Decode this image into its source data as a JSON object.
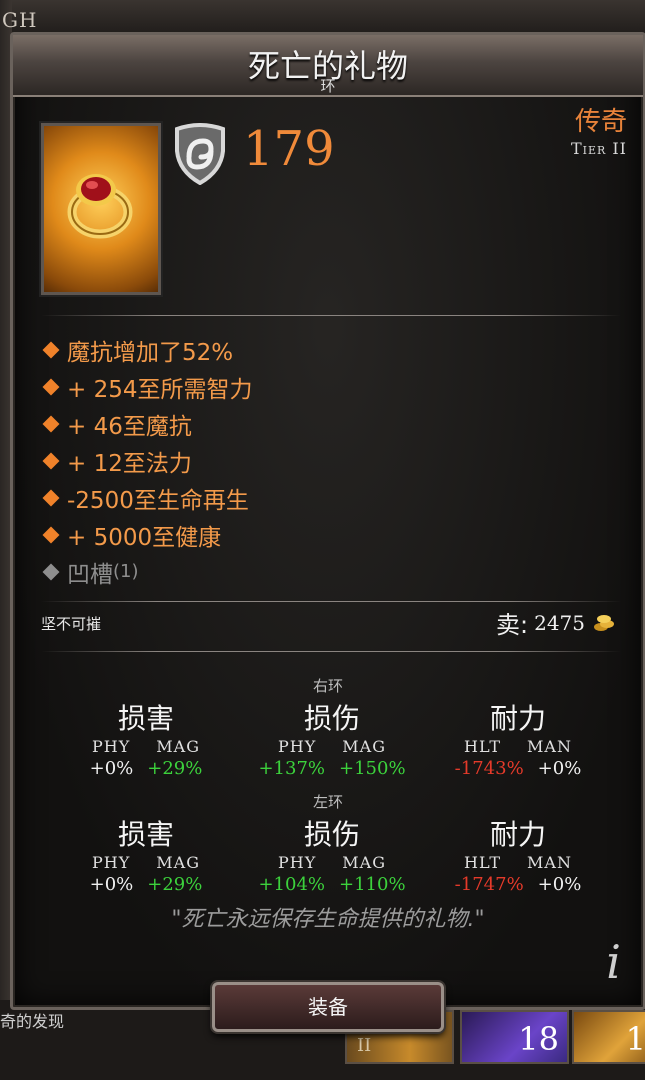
{
  "background": {
    "top_tag": "GH",
    "bottom_left_text": "奇的发现",
    "slots": [
      {
        "label": "II",
        "count": ""
      },
      {
        "label": "",
        "count": "18"
      },
      {
        "label": "",
        "count": "1"
      }
    ]
  },
  "item": {
    "title": "死亡的礼物",
    "type": "环",
    "power": "179",
    "rarity": "传奇",
    "tier": "Tier II",
    "rarity_color": "#e8833a",
    "stats": [
      {
        "text": "魔抗增加了52%"
      },
      {
        "text": "+ 254至所需智力"
      },
      {
        "text": "+ 46至魔抗"
      },
      {
        "text": "+ 12至法力"
      },
      {
        "text": "-2500至生命再生"
      },
      {
        "text": "+ 5000至健康"
      }
    ],
    "socket": {
      "label": "凹槽",
      "count": "(1)"
    },
    "quality": "坚不可摧",
    "sell_label": "卖:",
    "sell_value": "2475",
    "icons": {
      "item": "ring-icon",
      "power": "shield-icon",
      "currency": "gold-coins-icon",
      "info": "info-icon"
    }
  },
  "comparison": [
    {
      "label": "右环",
      "columns": [
        {
          "title": "损害",
          "sub": [
            "PHY",
            "MAG"
          ],
          "vals": [
            {
              "v": "+0%",
              "c": "white"
            },
            {
              "v": "+29%",
              "c": "green"
            }
          ]
        },
        {
          "title": "损伤",
          "sub": [
            "PHY",
            "MAG"
          ],
          "vals": [
            {
              "v": "+137%",
              "c": "green"
            },
            {
              "v": "+150%",
              "c": "green"
            }
          ]
        },
        {
          "title": "耐力",
          "sub": [
            "HLT",
            "MAN"
          ],
          "vals": [
            {
              "v": "-1743%",
              "c": "red"
            },
            {
              "v": "+0%",
              "c": "white"
            }
          ]
        }
      ]
    },
    {
      "label": "左环",
      "columns": [
        {
          "title": "损害",
          "sub": [
            "PHY",
            "MAG"
          ],
          "vals": [
            {
              "v": "+0%",
              "c": "white"
            },
            {
              "v": "+29%",
              "c": "green"
            }
          ]
        },
        {
          "title": "损伤",
          "sub": [
            "PHY",
            "MAG"
          ],
          "vals": [
            {
              "v": "+104%",
              "c": "green"
            },
            {
              "v": "+110%",
              "c": "green"
            }
          ]
        },
        {
          "title": "耐力",
          "sub": [
            "HLT",
            "MAN"
          ],
          "vals": [
            {
              "v": "-1747%",
              "c": "red"
            },
            {
              "v": "+0%",
              "c": "white"
            }
          ]
        }
      ]
    }
  ],
  "flavor": "\"死亡永远保存生命提供的礼物.\"",
  "equip_label": "装备",
  "info_glyph": "i"
}
